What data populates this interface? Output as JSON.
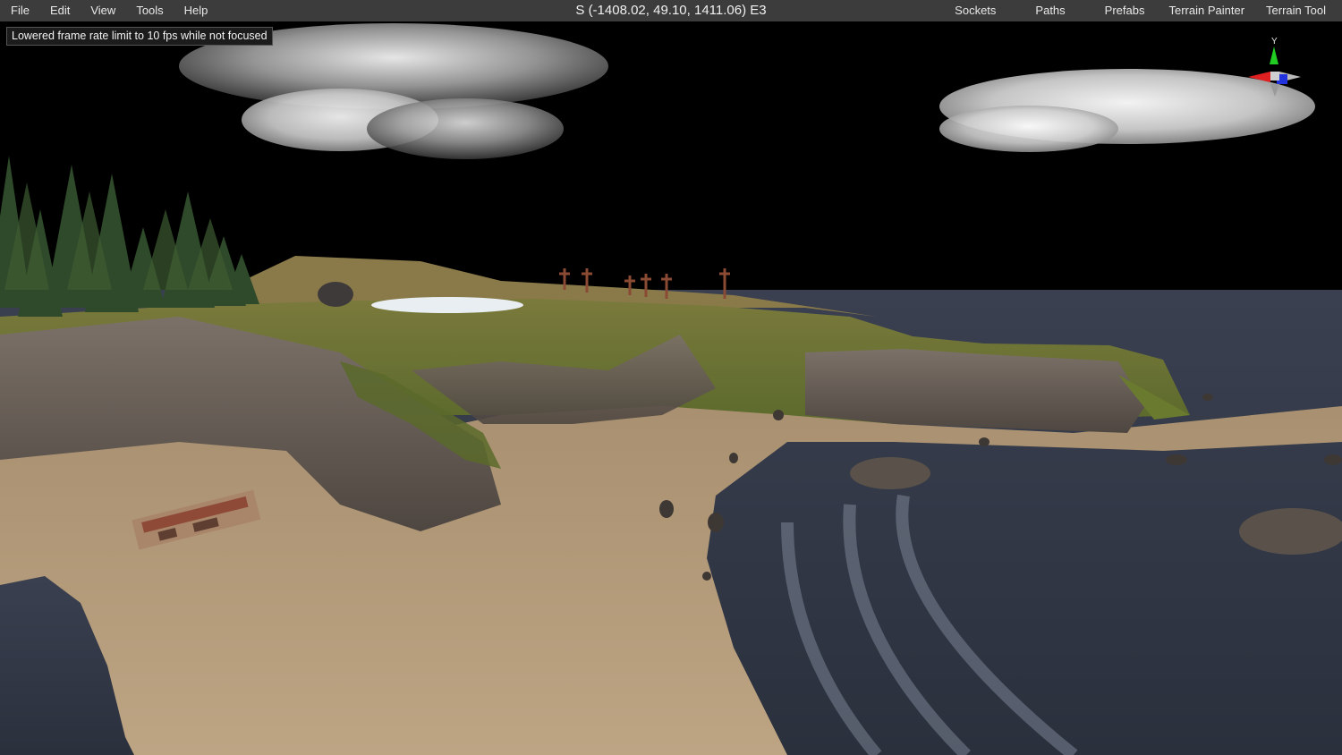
{
  "menu": {
    "items": [
      "File",
      "Edit",
      "View",
      "Tools",
      "Help"
    ]
  },
  "camera": {
    "readout": "S (-1408.02, 49.10, 1411.06) E3"
  },
  "tools": {
    "tabs": [
      "Sockets",
      "Paths",
      "Prefabs",
      "Terrain Painter",
      "Terrain Tool"
    ]
  },
  "viewport": {
    "notice": "Lowered frame rate limit to 10 fps while not focused",
    "gizmo_axis_label": "Y"
  },
  "colors": {
    "menubar": "#3c3c3c",
    "sky": "#000000",
    "water": "#2f3644",
    "sand": "#b19a7b",
    "grass": "#6a7434",
    "rock": "#6d645c",
    "axis_x": "#e02020",
    "axis_y": "#22cc22",
    "axis_z": "#2233dd"
  }
}
